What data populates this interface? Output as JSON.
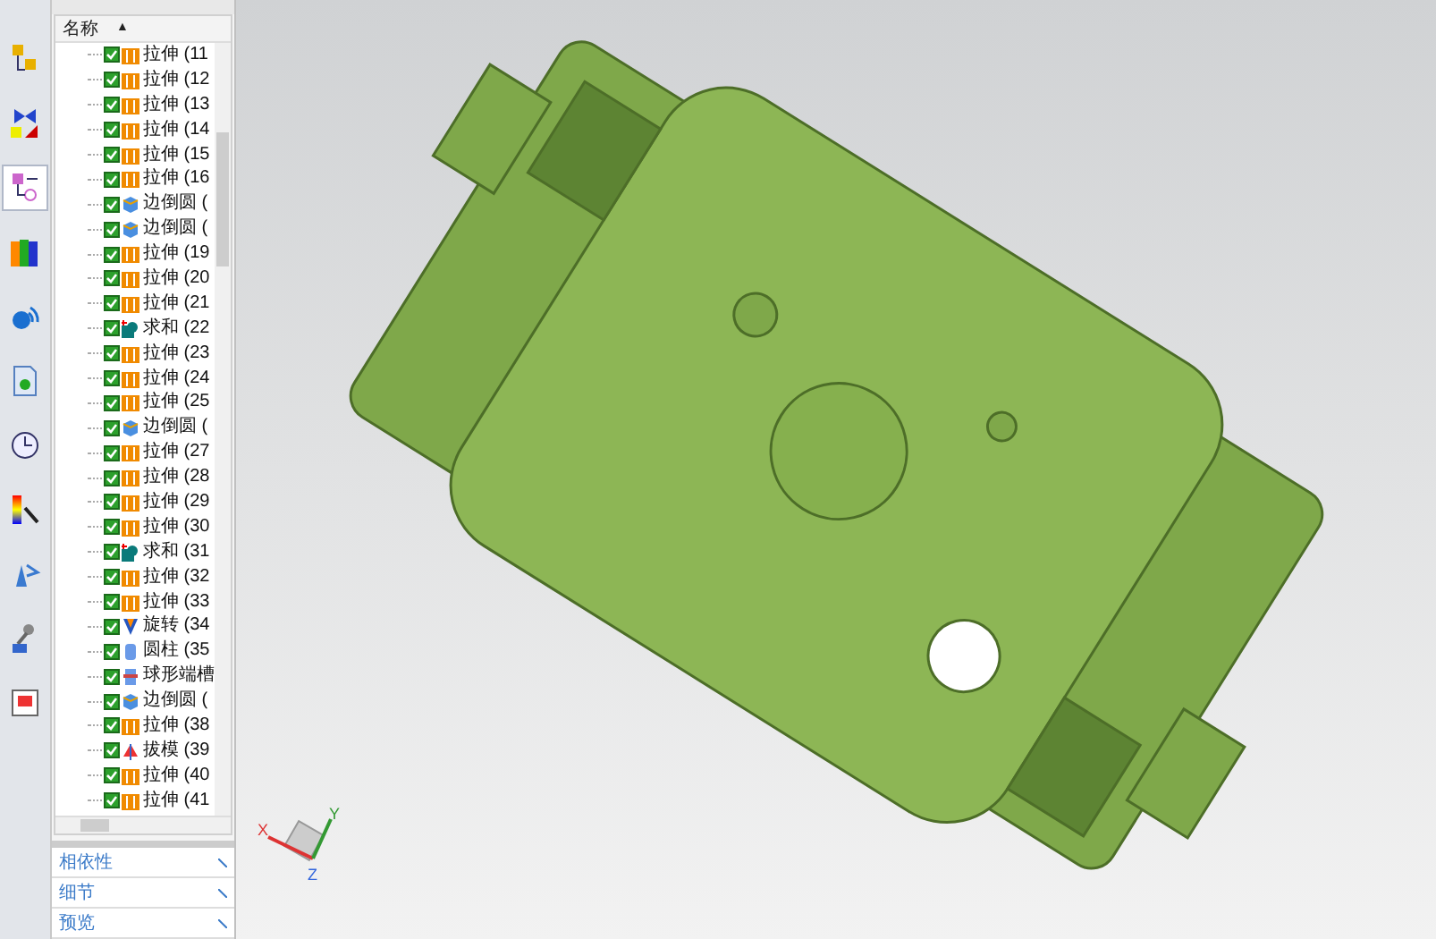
{
  "toolbar": [
    {
      "kind": "nodes",
      "selected": false
    },
    {
      "kind": "shapes",
      "selected": false
    },
    {
      "kind": "tree",
      "selected": true
    },
    {
      "kind": "books",
      "selected": false
    },
    {
      "kind": "signal",
      "selected": false
    },
    {
      "kind": "document",
      "selected": false
    },
    {
      "kind": "clock",
      "selected": false
    },
    {
      "kind": "gradient",
      "selected": false
    },
    {
      "kind": "figure",
      "selected": false
    },
    {
      "kind": "tools",
      "selected": false
    },
    {
      "kind": "calendar",
      "selected": false
    }
  ],
  "tree": {
    "header": "名称",
    "sort_mark": "▲",
    "rows": [
      {
        "label": "拉伸 (11",
        "kind": "extrude",
        "checked": true
      },
      {
        "label": "拉伸 (12",
        "kind": "extrude",
        "checked": true
      },
      {
        "label": "拉伸 (13",
        "kind": "extrude",
        "checked": true
      },
      {
        "label": "拉伸 (14",
        "kind": "extrude",
        "checked": true
      },
      {
        "label": "拉伸 (15",
        "kind": "extrude",
        "checked": true
      },
      {
        "label": "拉伸 (16",
        "kind": "extrude",
        "checked": true
      },
      {
        "label": "边倒圆 (",
        "kind": "blend",
        "checked": true
      },
      {
        "label": "边倒圆 (",
        "kind": "blend",
        "checked": true
      },
      {
        "label": "拉伸 (19",
        "kind": "extrude",
        "checked": true
      },
      {
        "label": "拉伸 (20",
        "kind": "extrude",
        "checked": true
      },
      {
        "label": "拉伸 (21",
        "kind": "extrude",
        "checked": true
      },
      {
        "label": "求和 (22",
        "kind": "unite",
        "checked": true
      },
      {
        "label": "拉伸 (23",
        "kind": "extrude",
        "checked": true
      },
      {
        "label": "拉伸 (24",
        "kind": "extrude",
        "checked": true
      },
      {
        "label": "拉伸 (25",
        "kind": "extrude",
        "checked": true
      },
      {
        "label": "边倒圆 (",
        "kind": "blend",
        "checked": true
      },
      {
        "label": "拉伸 (27",
        "kind": "extrude",
        "checked": true
      },
      {
        "label": "拉伸 (28",
        "kind": "extrude",
        "checked": true
      },
      {
        "label": "拉伸 (29",
        "kind": "extrude",
        "checked": true
      },
      {
        "label": "拉伸 (30",
        "kind": "extrude",
        "checked": true
      },
      {
        "label": "求和 (31",
        "kind": "unite",
        "checked": true
      },
      {
        "label": "拉伸 (32",
        "kind": "extrude",
        "checked": true
      },
      {
        "label": "拉伸 (33",
        "kind": "extrude",
        "checked": true
      },
      {
        "label": "旋转 (34",
        "kind": "revolve",
        "checked": true
      },
      {
        "label": "圆柱 (35",
        "kind": "cylinder",
        "checked": true
      },
      {
        "label": "球形端槽",
        "kind": "groove",
        "checked": true
      },
      {
        "label": "边倒圆 (",
        "kind": "blend",
        "checked": true
      },
      {
        "label": "拉伸 (38",
        "kind": "extrude",
        "checked": true
      },
      {
        "label": "拔模 (39",
        "kind": "draft",
        "checked": true
      },
      {
        "label": "拉伸 (40",
        "kind": "extrude",
        "checked": true
      },
      {
        "label": "拉伸 (41",
        "kind": "extrude",
        "checked": true
      }
    ]
  },
  "sections": [
    "相依性",
    "细节",
    "预览"
  ],
  "triad": {
    "x": "X",
    "y": "Y",
    "z": "Z"
  }
}
